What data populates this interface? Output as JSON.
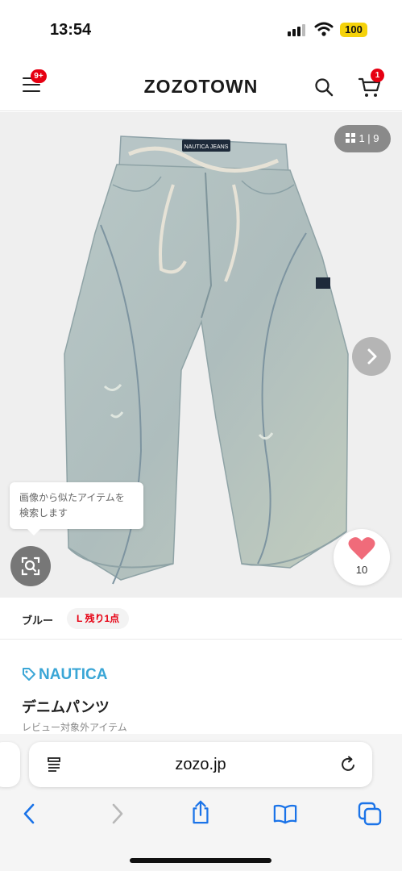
{
  "status_bar": {
    "time": "13:54",
    "battery": "100",
    "icons": [
      "signal-icon",
      "wifi-icon",
      "battery-icon"
    ]
  },
  "header": {
    "menu_badge": "9+",
    "logo": "ZOZOTOWN",
    "cart_badge": "1",
    "icons": [
      "menu-icon",
      "search-icon",
      "cart-icon"
    ]
  },
  "gallery": {
    "counter": "1 | 9",
    "image_label": "NAUTICA JEANS",
    "tooltip": "画像から似たアイテムを検索します",
    "like_count": "10",
    "icons": [
      "grid-icon",
      "chevron-right-icon",
      "visual-search-icon",
      "heart-icon"
    ]
  },
  "product": {
    "color": "ブルー",
    "stock": "L 残り1点",
    "brand": "NAUTICA",
    "title": "デニムパンツ",
    "review_note": "レビュー対象外アイテム"
  },
  "browser": {
    "url": "zozo.jp",
    "icons": [
      "reader-icon",
      "reload-icon",
      "back-icon",
      "forward-icon",
      "share-icon",
      "bookmarks-icon",
      "tabs-icon"
    ]
  },
  "colors": {
    "accent_red": "#e60012",
    "brand_blue": "#3aa6d6",
    "like_pink": "#f06b7a",
    "denim": "#b4c3c4"
  }
}
